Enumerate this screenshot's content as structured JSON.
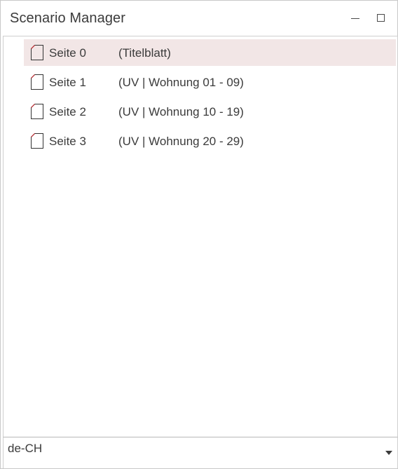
{
  "window": {
    "title": "Scenario Manager"
  },
  "pages": [
    {
      "name": "Seite 0",
      "description": "(Titelblatt)",
      "selected": true
    },
    {
      "name": "Seite 1",
      "description": "(UV | Wohnung 01 - 09)",
      "selected": false
    },
    {
      "name": "Seite 2",
      "description": "(UV | Wohnung 10 - 19)",
      "selected": false
    },
    {
      "name": "Seite 3",
      "description": "(UV | Wohnung 20 - 29)",
      "selected": false
    }
  ],
  "language": {
    "selected": "de-CH"
  },
  "colors": {
    "selection": "#f2e6e6",
    "icon_accent": "#c0272d",
    "text": "#3b3b3b"
  },
  "icons": {
    "page": "page-icon",
    "minimize": "minimize-icon",
    "maximize": "maximize-icon",
    "dropdown": "chevron-down-icon"
  }
}
